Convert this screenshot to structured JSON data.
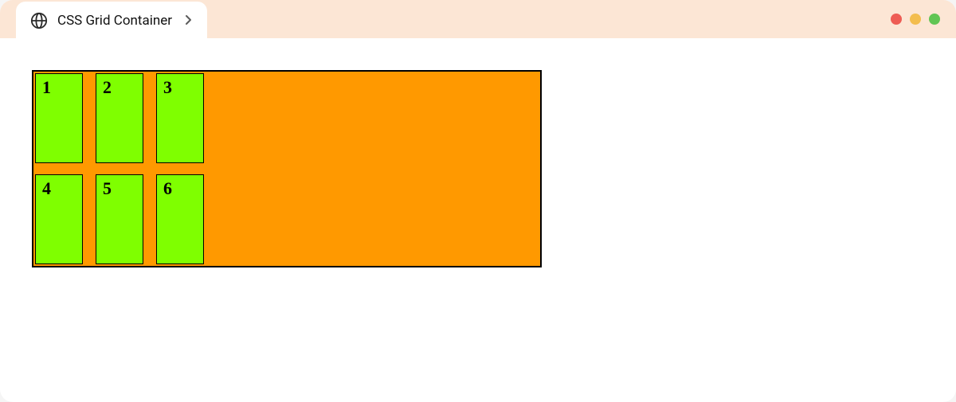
{
  "tab": {
    "title": "CSS Grid Container"
  },
  "grid": {
    "items": [
      {
        "label": "1"
      },
      {
        "label": "2"
      },
      {
        "label": "3"
      },
      {
        "label": "4"
      },
      {
        "label": "5"
      },
      {
        "label": "6"
      }
    ]
  },
  "colors": {
    "title_bar_bg": "#fce6d5",
    "grid_bg": "#ff9900",
    "cell_bg": "#7fff00"
  }
}
